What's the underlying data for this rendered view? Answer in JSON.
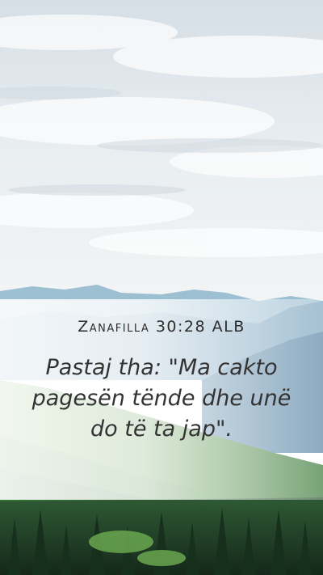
{
  "verse": {
    "reference": "Zanafilla 30:28 ALB",
    "text": "Pastaj tha: \"Ma cakto pagesën tënde dhe unë do të ta jap\"."
  },
  "colors": {
    "sky_top": "#dfe6ec",
    "sky_bottom": "#eef1f2",
    "mountain_far": "#8fb3c8",
    "mountain_mid": "#5f8fae",
    "hillside_green": "#5e9a48",
    "forest_dark": "#1f3a26"
  }
}
